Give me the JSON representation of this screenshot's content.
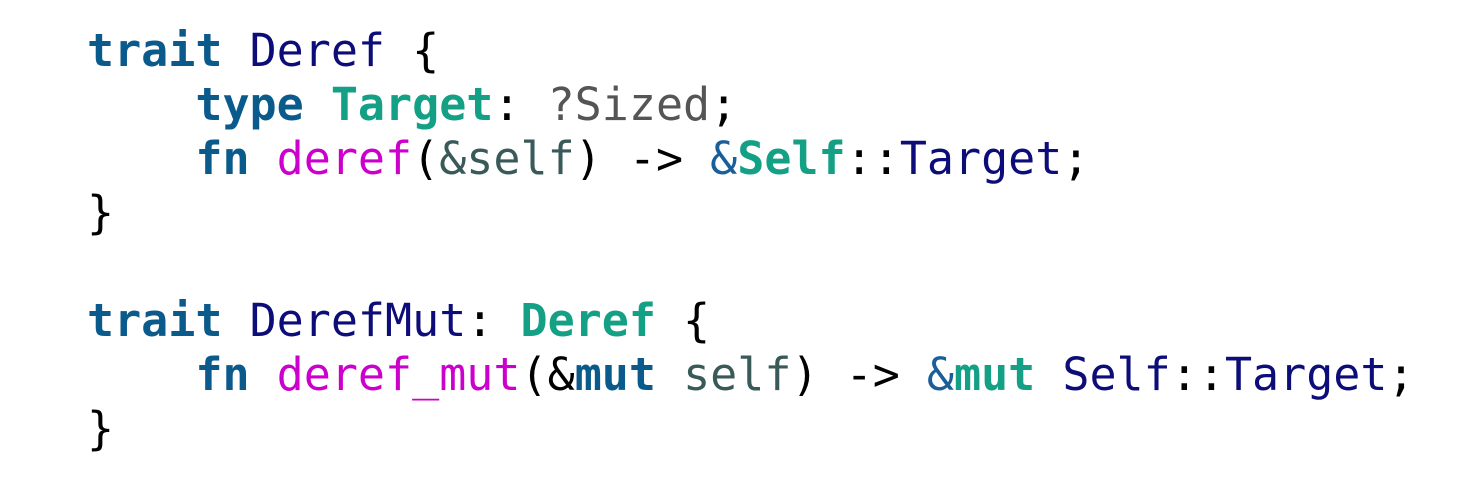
{
  "code_block": {
    "lines": [
      [
        {
          "text": "trait",
          "cls": "kw"
        },
        {
          "text": " ",
          "cls": "pun"
        },
        {
          "text": "Deref",
          "cls": "ty"
        },
        {
          "text": " {",
          "cls": "pun"
        }
      ],
      [
        {
          "text": "    ",
          "cls": "pun"
        },
        {
          "text": "type",
          "cls": "kw"
        },
        {
          "text": " ",
          "cls": "pun"
        },
        {
          "text": "Target",
          "cls": "tyb"
        },
        {
          "text": ": ",
          "cls": "pun"
        },
        {
          "text": "?Sized",
          "cls": "gry"
        },
        {
          "text": ";",
          "cls": "pun"
        }
      ],
      [
        {
          "text": "    ",
          "cls": "pun"
        },
        {
          "text": "fn",
          "cls": "kw"
        },
        {
          "text": " ",
          "cls": "pun"
        },
        {
          "text": "deref",
          "cls": "fn"
        },
        {
          "text": "(",
          "cls": "pun"
        },
        {
          "text": "&self",
          "cls": "var"
        },
        {
          "text": ") -> ",
          "cls": "pun"
        },
        {
          "text": "&",
          "cls": "amp"
        },
        {
          "text": "Self",
          "cls": "tyb"
        },
        {
          "text": "::",
          "cls": "pun"
        },
        {
          "text": "Target",
          "cls": "ty"
        },
        {
          "text": ";",
          "cls": "pun"
        }
      ],
      [
        {
          "text": "}",
          "cls": "pun"
        }
      ],
      [],
      [
        {
          "text": "trait",
          "cls": "kw"
        },
        {
          "text": " ",
          "cls": "pun"
        },
        {
          "text": "DerefMut",
          "cls": "ty"
        },
        {
          "text": ": ",
          "cls": "pun"
        },
        {
          "text": "Deref",
          "cls": "tyb"
        },
        {
          "text": " {",
          "cls": "pun"
        }
      ],
      [
        {
          "text": "    ",
          "cls": "pun"
        },
        {
          "text": "fn",
          "cls": "kw"
        },
        {
          "text": " ",
          "cls": "pun"
        },
        {
          "text": "deref_mut",
          "cls": "fn"
        },
        {
          "text": "(&",
          "cls": "pun"
        },
        {
          "text": "mut",
          "cls": "kw"
        },
        {
          "text": " ",
          "cls": "pun"
        },
        {
          "text": "self",
          "cls": "var"
        },
        {
          "text": ") -> ",
          "cls": "pun"
        },
        {
          "text": "&",
          "cls": "amp"
        },
        {
          "text": "mut",
          "cls": "tyb"
        },
        {
          "text": " ",
          "cls": "pun"
        },
        {
          "text": "Self",
          "cls": "ty"
        },
        {
          "text": "::",
          "cls": "pun"
        },
        {
          "text": "Target",
          "cls": "ty"
        },
        {
          "text": ";",
          "cls": "pun"
        }
      ],
      [
        {
          "text": "}",
          "cls": "pun"
        }
      ]
    ]
  },
  "colors": {
    "keyword": "#0b5a8c",
    "type": "#0d0d7a",
    "type_bold": "#13a085",
    "function": "#cc00cc",
    "variable": "#3a5a5a",
    "background": "#ffffff"
  }
}
